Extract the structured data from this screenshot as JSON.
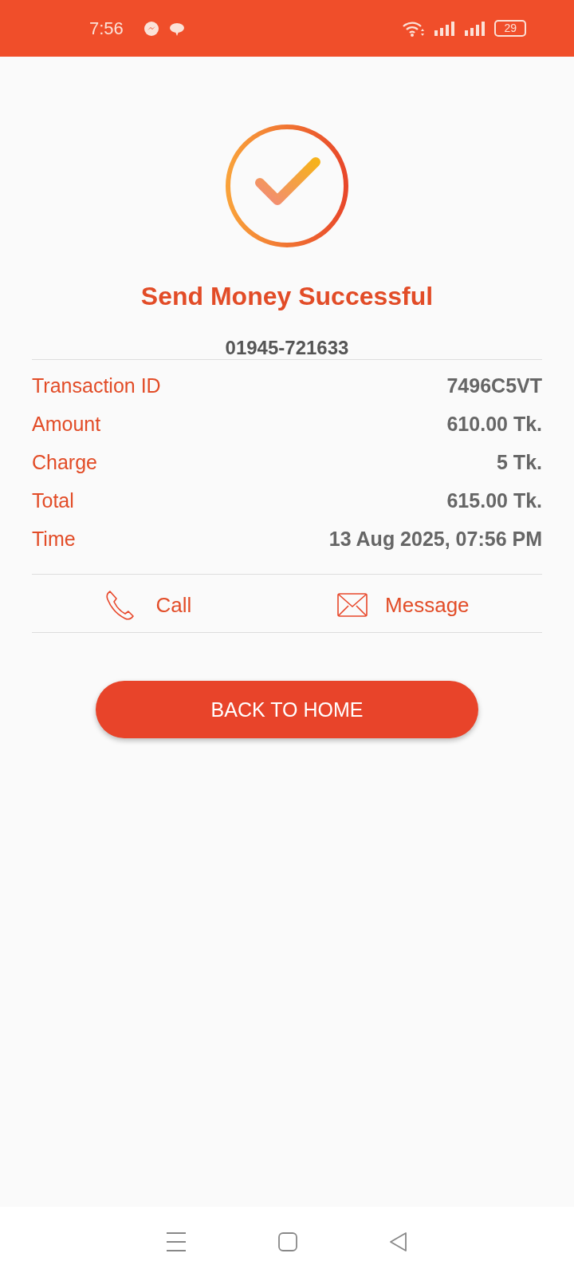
{
  "status_bar": {
    "time": "7:56",
    "battery": "29"
  },
  "result": {
    "title": "Send Money Successful",
    "recipient": "01945-721633"
  },
  "details": [
    {
      "label": "Transaction ID",
      "value": "7496C5VT"
    },
    {
      "label": "Amount",
      "value": "610.00 Tk."
    },
    {
      "label": "Charge",
      "value": "5 Tk."
    },
    {
      "label": "Total",
      "value": "615.00 Tk."
    },
    {
      "label": "Time",
      "value": "13 Aug 2025, 07:56 PM"
    }
  ],
  "actions": [
    {
      "kind": "call",
      "label": "Call"
    },
    {
      "kind": "message",
      "label": "Message"
    }
  ],
  "button": "BACK TO HOME"
}
